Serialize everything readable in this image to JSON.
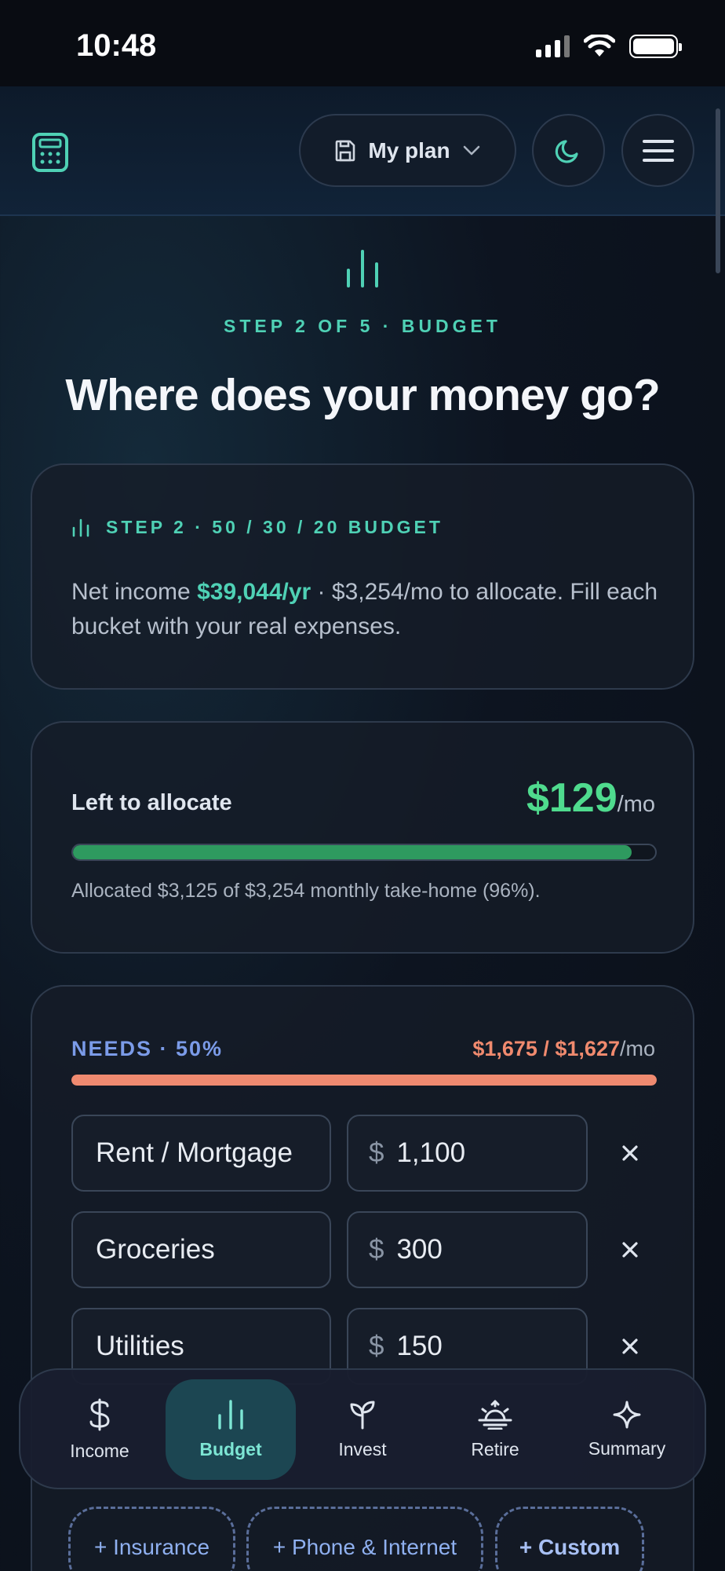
{
  "status_bar": {
    "time": "10:48"
  },
  "header": {
    "plan_label": "My plan"
  },
  "hero": {
    "step_label": "STEP 2 OF 5 · BUDGET",
    "title": "Where does your money go?"
  },
  "intro_card": {
    "heading": "STEP 2 · 50 / 30 / 20 BUDGET",
    "text_before": "Net income ",
    "net_income": "$39,044/yr",
    "text_after": " · $3,254/mo to allocate. Fill each bucket with your real expenses."
  },
  "allocation_card": {
    "label": "Left to allocate",
    "amount": "$129",
    "unit": "/mo",
    "progress_fraction": 0.96,
    "caption": "Allocated $3,125 of $3,254 monthly take-home (96%)."
  },
  "needs": {
    "heading": "NEEDS · 50%",
    "total": "$1,675 / $1,627",
    "unit": "/mo",
    "progress_fraction": 1.0,
    "rows": [
      {
        "name": "Rent / Mortgage",
        "currency": "$",
        "amount": "1,100"
      },
      {
        "name": "Groceries",
        "currency": "$",
        "amount": "300"
      },
      {
        "name": "Utilities",
        "currency": "$",
        "amount": "150"
      }
    ]
  },
  "add_chips": [
    "+ Insurance",
    "+ Phone & Internet",
    "+ Custom"
  ],
  "bottom_nav": [
    {
      "label": "Income",
      "icon": "dollar-icon"
    },
    {
      "label": "Budget",
      "icon": "bar-chart-icon",
      "active": true
    },
    {
      "label": "Invest",
      "icon": "sprout-icon"
    },
    {
      "label": "Retire",
      "icon": "sunset-icon"
    },
    {
      "label": "Summary",
      "icon": "sparkle-icon"
    }
  ],
  "colors": {
    "accent_teal": "#4fd1b5",
    "positive_green": "#4fdb8e",
    "needs_blue": "#7b9be8",
    "over_budget_coral": "#ef8a70"
  }
}
